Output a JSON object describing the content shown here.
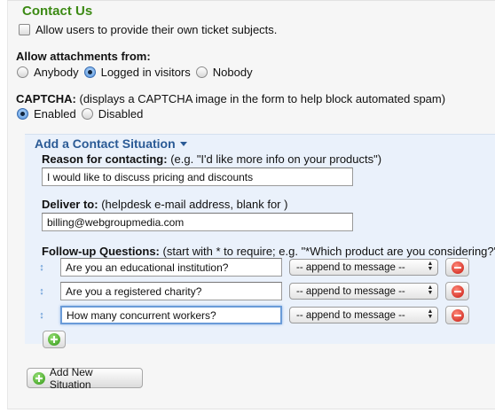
{
  "contact_us": {
    "title": "Contact Us",
    "allow_subjects_label": "Allow users to provide their own ticket subjects.",
    "allow_subjects_checked": false
  },
  "attachments": {
    "label": "Allow attachments from:",
    "options": [
      "Anybody",
      "Logged in visitors",
      "Nobody"
    ],
    "selected": "Logged in visitors"
  },
  "captcha": {
    "label": "CAPTCHA:",
    "description": " (displays a CAPTCHA image in the form to help block automated spam)",
    "options": [
      "Enabled",
      "Disabled"
    ],
    "selected": "Enabled"
  },
  "situation": {
    "title": "Add a Contact Situation",
    "reason": {
      "label": "Reason for contacting:",
      "hint": " (e.g. \"I'd like more info on your products\")",
      "value": "I would like to discuss pricing and discounts"
    },
    "deliver": {
      "label": "Deliver to:",
      "hint": " (helpdesk e-mail address, blank for )",
      "value": "billing@webgroupmedia.com"
    },
    "followup": {
      "label": "Follow-up Questions:",
      "hint": " (start with * to require; e.g. \"*Which product are you considering?\")",
      "questions": [
        {
          "text": "Are you an educational institution?",
          "action": "-- append to message --"
        },
        {
          "text": "Are you a registered charity?",
          "action": "-- append to message --"
        },
        {
          "text": "How many concurrent workers?",
          "action": "-- append to message --"
        }
      ]
    }
  },
  "add_situation_label": "Add New Situation"
}
